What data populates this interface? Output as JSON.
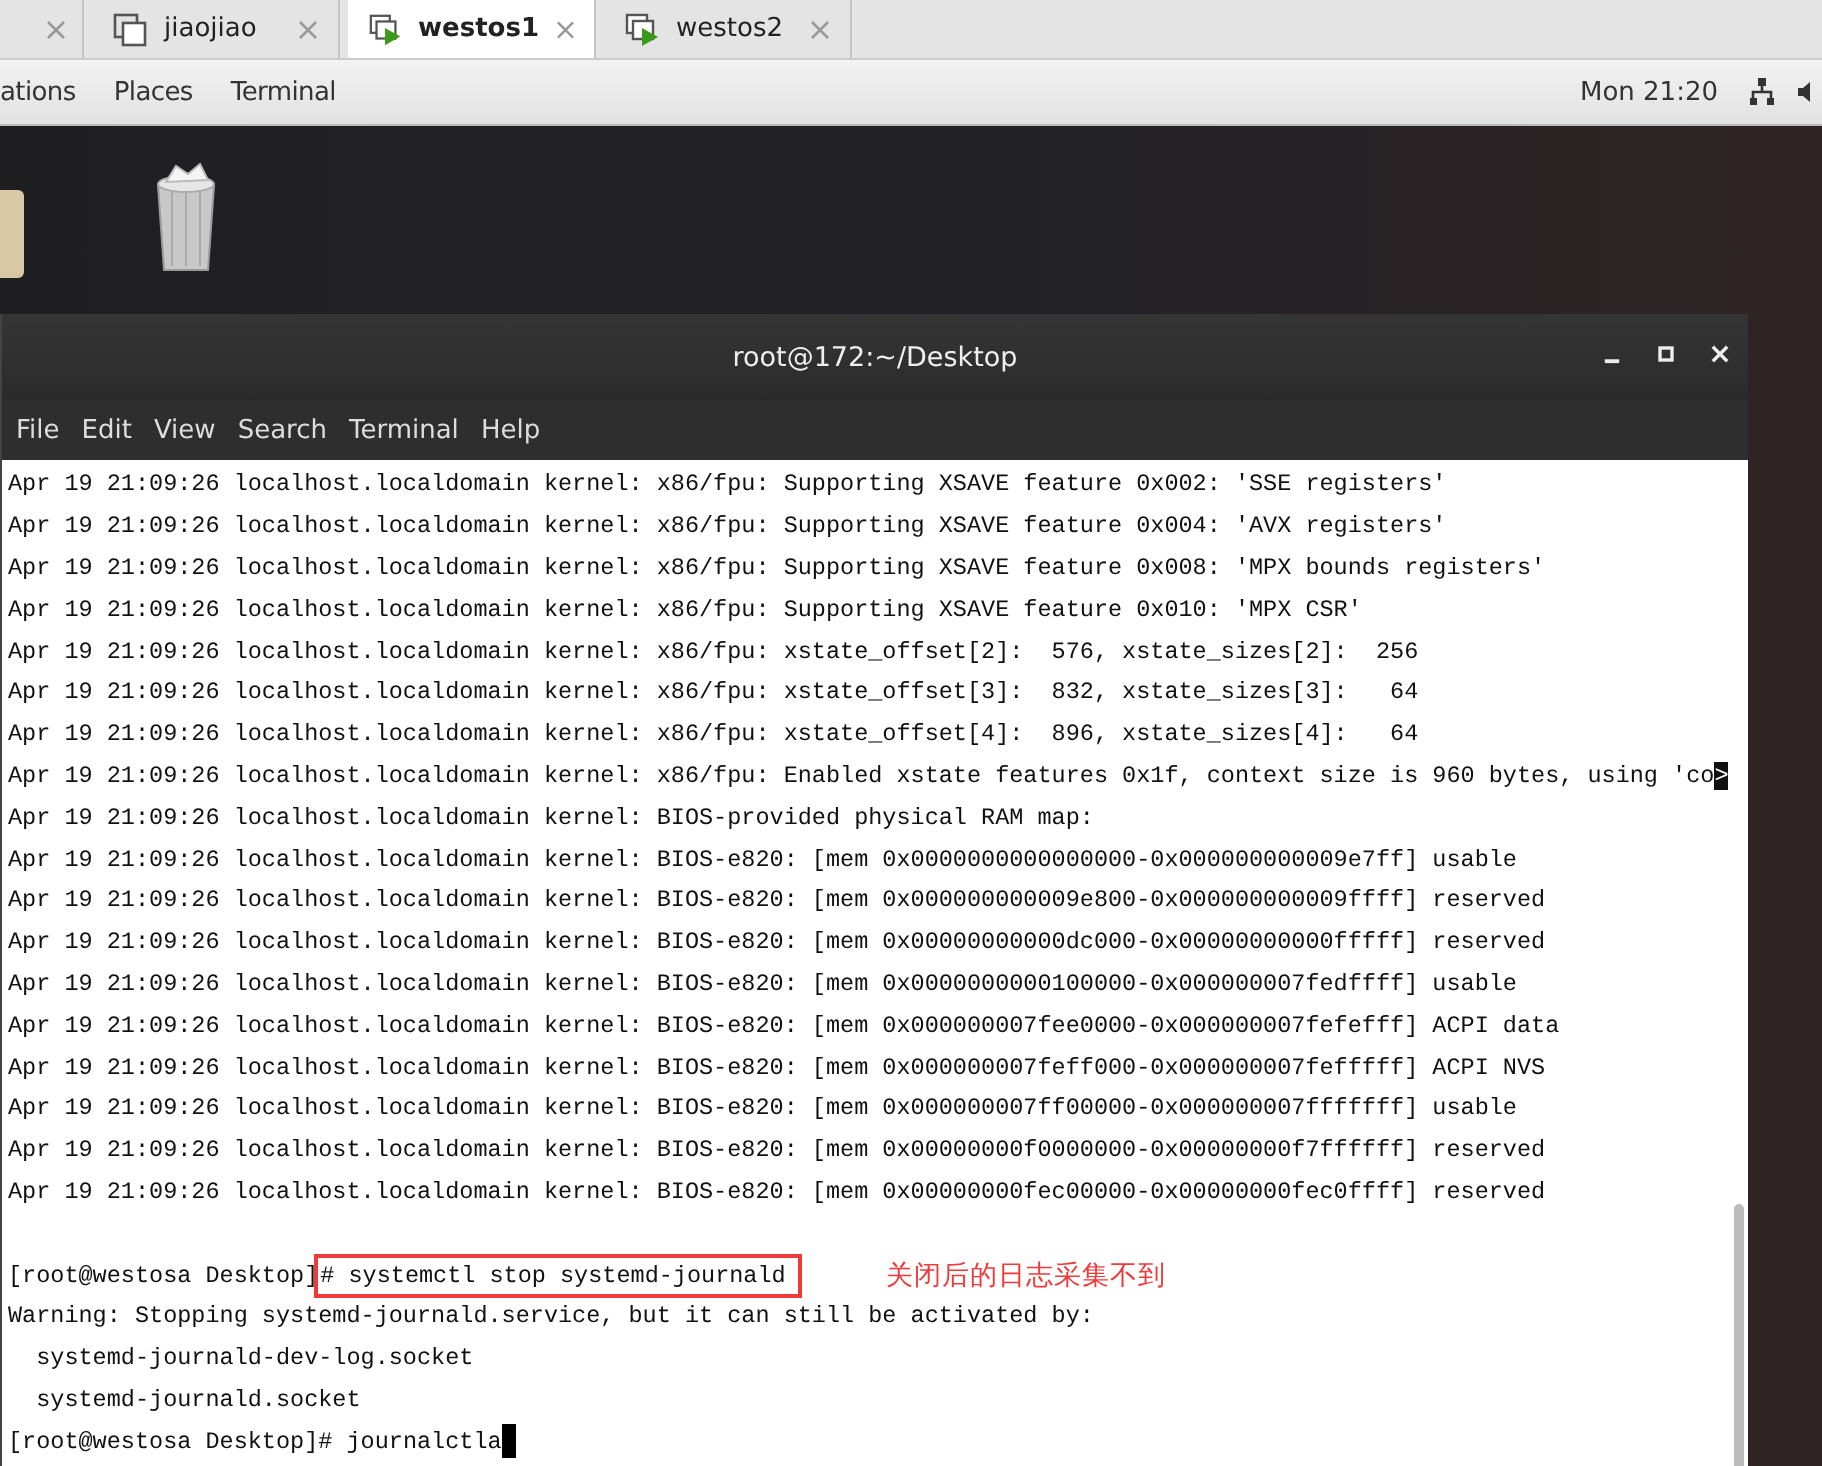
{
  "vm_tabs": [
    {
      "selected": false
    },
    {
      "label": "jiaojiao",
      "selected": false,
      "kind": "plain"
    },
    {
      "label": "westos1",
      "selected": true,
      "kind": "vm"
    },
    {
      "label": "westos2",
      "selected": false,
      "kind": "vm"
    }
  ],
  "top_bar": {
    "menus": [
      "ations",
      "Places",
      "Terminal"
    ],
    "clock": "Mon 21:20"
  },
  "terminal": {
    "title": "root@172:~/Desktop",
    "menu": [
      "File",
      "Edit",
      "View",
      "Search",
      "Terminal",
      "Help"
    ],
    "lines": [
      {
        "kind": "text",
        "text": "Apr 19 21:09:26 localhost.localdomain kernel: x86/fpu: Supporting XSAVE feature 0x002: 'SSE registers'"
      },
      {
        "kind": "text",
        "text": "Apr 19 21:09:26 localhost.localdomain kernel: x86/fpu: Supporting XSAVE feature 0x004: 'AVX registers'"
      },
      {
        "kind": "text",
        "text": "Apr 19 21:09:26 localhost.localdomain kernel: x86/fpu: Supporting XSAVE feature 0x008: 'MPX bounds registers'"
      },
      {
        "kind": "text",
        "text": "Apr 19 21:09:26 localhost.localdomain kernel: x86/fpu: Supporting XSAVE feature 0x010: 'MPX CSR'"
      },
      {
        "kind": "text",
        "text": "Apr 19 21:09:26 localhost.localdomain kernel: x86/fpu: xstate_offset[2]:  576, xstate_sizes[2]:  256"
      },
      {
        "kind": "text",
        "text": "Apr 19 21:09:26 localhost.localdomain kernel: x86/fpu: xstate_offset[3]:  832, xstate_sizes[3]:   64"
      },
      {
        "kind": "text",
        "text": "Apr 19 21:09:26 localhost.localdomain kernel: x86/fpu: xstate_offset[4]:  896, xstate_sizes[4]:   64"
      },
      {
        "kind": "text",
        "text": "Apr 19 21:09:26 localhost.localdomain kernel: x86/fpu: Enabled xstate features 0x1f, context size is 960 bytes, using 'co",
        "marker": ">"
      },
      {
        "kind": "text",
        "text": "Apr 19 21:09:26 localhost.localdomain kernel: BIOS-provided physical RAM map:"
      },
      {
        "kind": "text",
        "text": "Apr 19 21:09:26 localhost.localdomain kernel: BIOS-e820: [mem 0x0000000000000000-0x000000000009e7ff] usable"
      },
      {
        "kind": "text",
        "text": "Apr 19 21:09:26 localhost.localdomain kernel: BIOS-e820: [mem 0x000000000009e800-0x000000000009ffff] reserved"
      },
      {
        "kind": "text",
        "text": "Apr 19 21:09:26 localhost.localdomain kernel: BIOS-e820: [mem 0x00000000000dc000-0x00000000000fffff] reserved"
      },
      {
        "kind": "text",
        "text": "Apr 19 21:09:26 localhost.localdomain kernel: BIOS-e820: [mem 0x0000000000100000-0x000000007fedffff] usable"
      },
      {
        "kind": "text",
        "text": "Apr 19 21:09:26 localhost.localdomain kernel: BIOS-e820: [mem 0x000000007fee0000-0x000000007fefefff] ACPI data"
      },
      {
        "kind": "text",
        "text": "Apr 19 21:09:26 localhost.localdomain kernel: BIOS-e820: [mem 0x000000007feff000-0x000000007fefffff] ACPI NVS"
      },
      {
        "kind": "text",
        "text": "Apr 19 21:09:26 localhost.localdomain kernel: BIOS-e820: [mem 0x000000007ff00000-0x000000007fffffff] usable"
      },
      {
        "kind": "text",
        "text": "Apr 19 21:09:26 localhost.localdomain kernel: BIOS-e820: [mem 0x00000000f0000000-0x00000000f7ffffff] reserved"
      },
      {
        "kind": "text",
        "text": "Apr 19 21:09:26 localhost.localdomain kernel: BIOS-e820: [mem 0x00000000fec00000-0x00000000fec0ffff] reserved"
      },
      {
        "kind": "blank"
      },
      {
        "kind": "prompt",
        "prompt": "[root@westosa Desktop]",
        "command": "# systemctl stop systemd-journald",
        "highlighted": true,
        "note": "关闭后的日志采集不到"
      },
      {
        "kind": "text",
        "text": "Warning: Stopping systemd-journald.service, but it can still be activated by:"
      },
      {
        "kind": "text",
        "text": "  systemd-journald-dev-log.socket"
      },
      {
        "kind": "text",
        "text": "  systemd-journald.socket"
      },
      {
        "kind": "prompt",
        "prompt": "[root@westosa Desktop]",
        "command": "# journalctla",
        "highlighted": false,
        "cursor": true
      }
    ]
  }
}
